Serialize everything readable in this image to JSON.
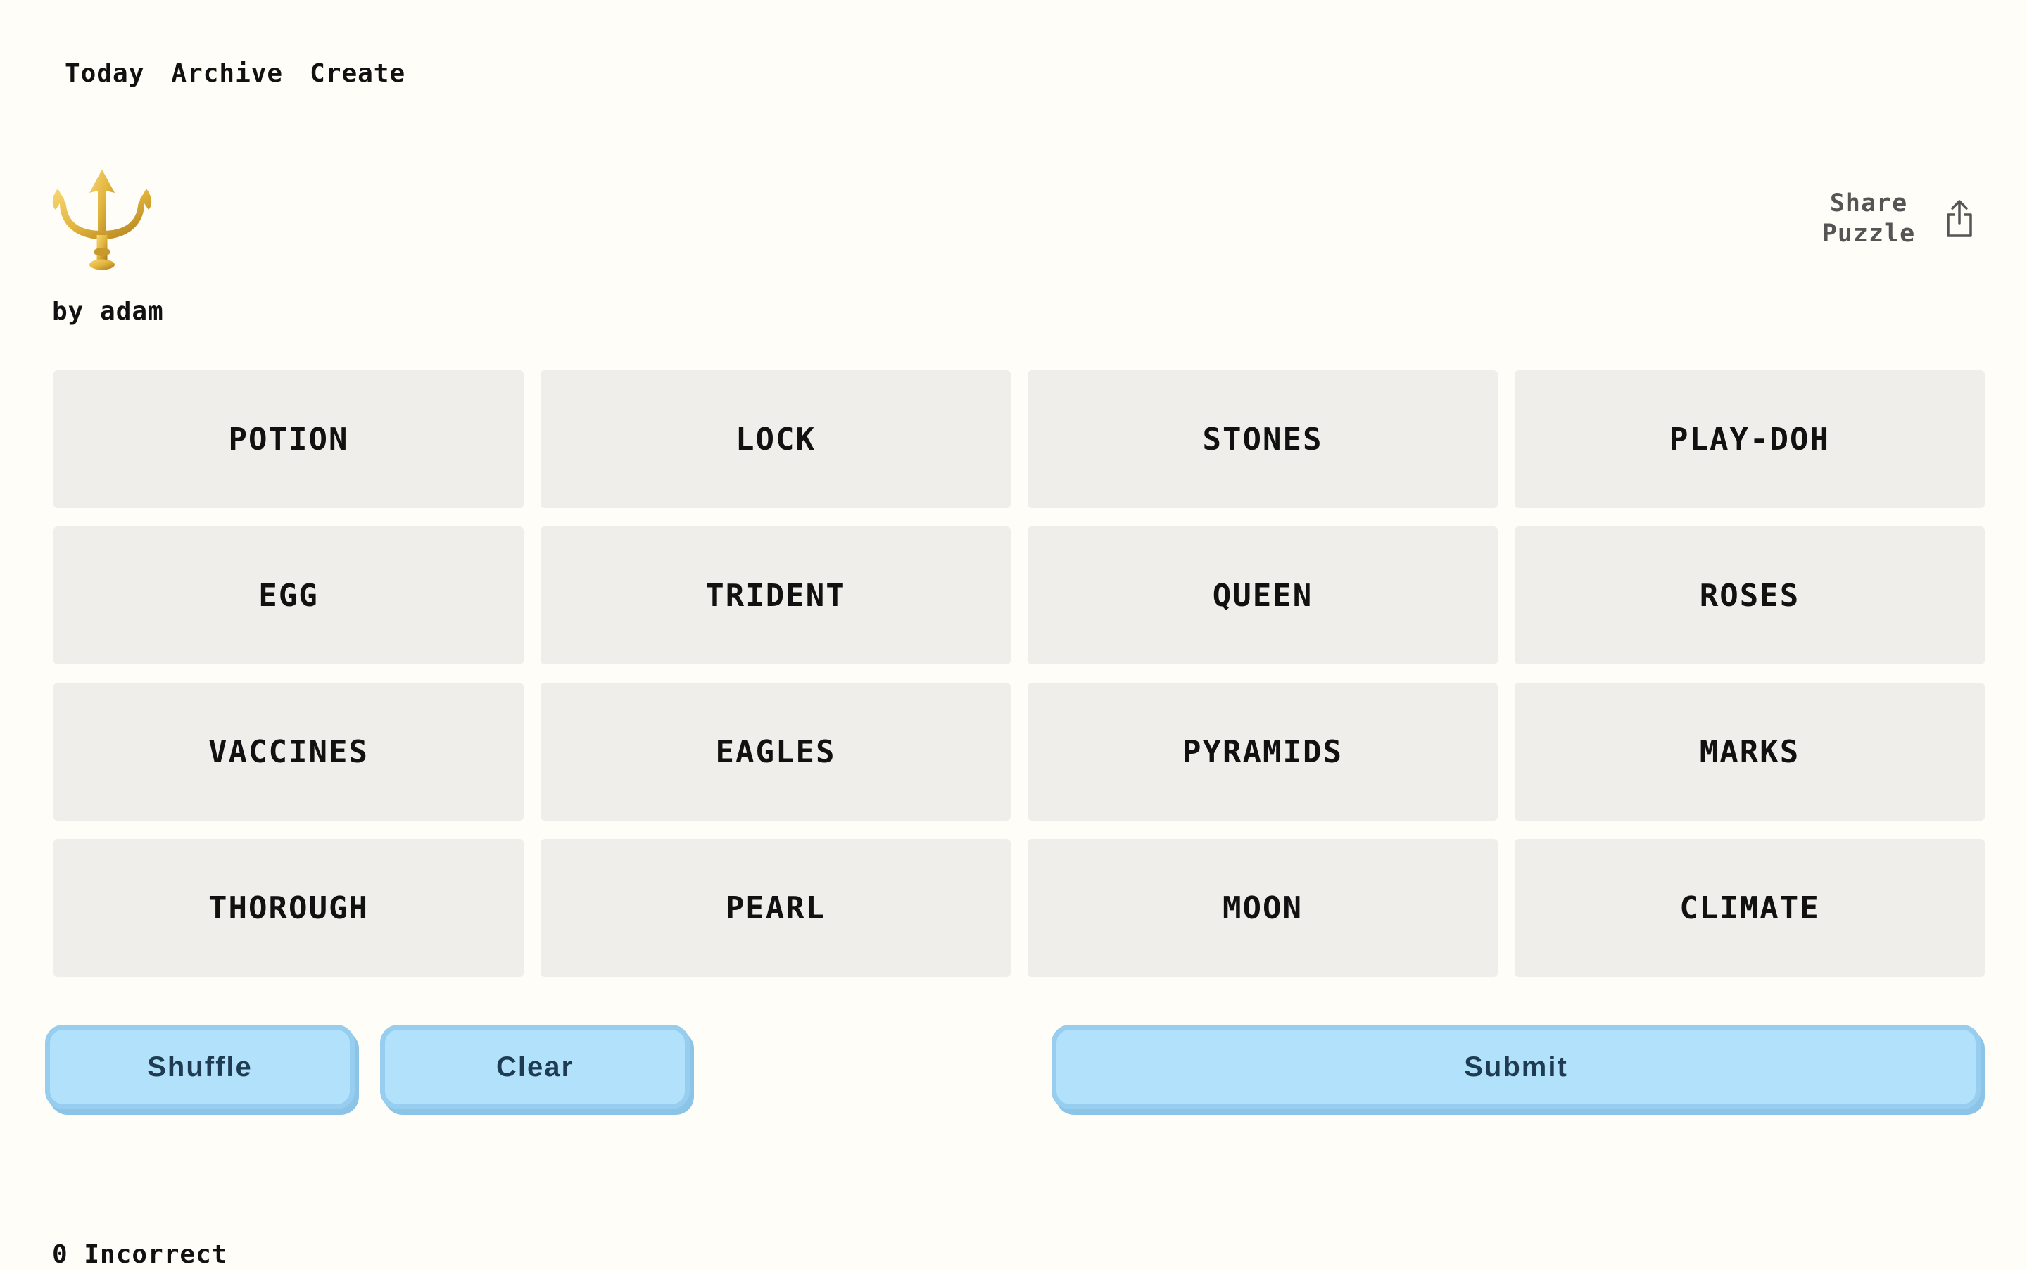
{
  "nav": {
    "today": "Today",
    "archive": "Archive",
    "create": "Create"
  },
  "puzzle": {
    "icon": "trident-emoji-icon",
    "author": "by adam"
  },
  "share": {
    "line1": "Share",
    "line2": "Puzzle",
    "icon": "share-icon"
  },
  "tiles": [
    "POTION",
    "LOCK",
    "STONES",
    "PLAY-DOH",
    "EGG",
    "TRIDENT",
    "QUEEN",
    "ROSES",
    "VACCINES",
    "EAGLES",
    "PYRAMIDS",
    "MARKS",
    "THOROUGH",
    "PEARL",
    "MOON",
    "CLIMATE"
  ],
  "actions": {
    "shuffle": "Shuffle",
    "clear": "Clear",
    "submit": "Submit"
  },
  "status": {
    "incorrect": "0 Incorrect"
  },
  "colors": {
    "background": "#fffdf8",
    "tile": "#efeeea",
    "button_fill": "#b1e1fb",
    "button_border": "#97cdee",
    "button_text": "#1f3b52",
    "trident_gold": "#e1b43c"
  }
}
